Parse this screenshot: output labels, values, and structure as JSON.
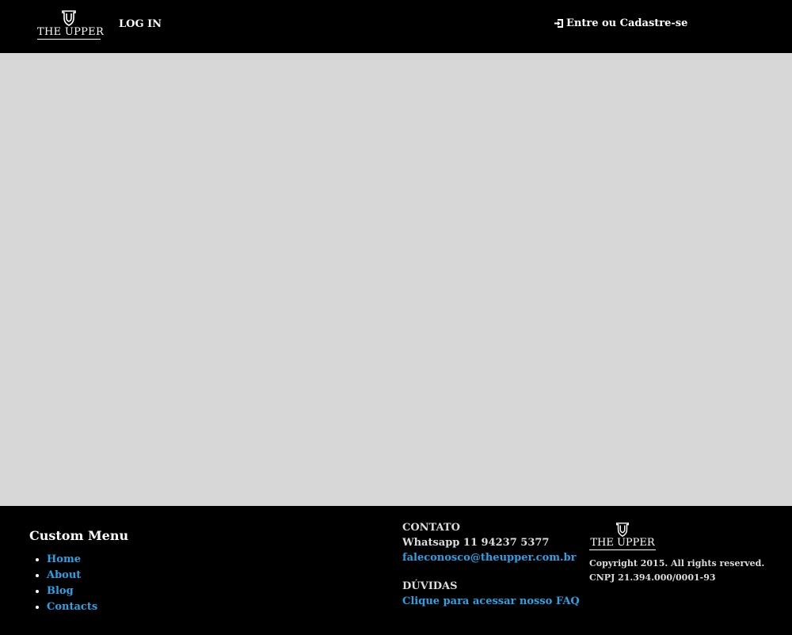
{
  "header": {
    "logo_text": "THE UPPER",
    "login_label": "LOG IN",
    "signin_label": "Entre ou Cadastre-se"
  },
  "footer": {
    "custom_menu": {
      "title": "Custom Menu",
      "items": [
        {
          "label": "Home"
        },
        {
          "label": "About"
        },
        {
          "label": "Blog"
        },
        {
          "label": "Contacts"
        }
      ]
    },
    "contact": {
      "heading": "CONTATO",
      "phone": "Whatsapp 11 94237 5377",
      "email": "faleconosco@theupper.com.br",
      "faq_heading": "DÚVIDAS",
      "faq_link": "Clique para acessar nosso FAQ"
    },
    "brand": {
      "logo_text": "THE UPPER",
      "copyright": "Copyright 2015. All rights reserved.",
      "cnpj": "CNPJ 21.394.000/0001-93"
    }
  },
  "colors": {
    "background": "#000000",
    "content_area": "#d7d7d7",
    "link": "#2aa3e6",
    "text": "#ffffff"
  }
}
